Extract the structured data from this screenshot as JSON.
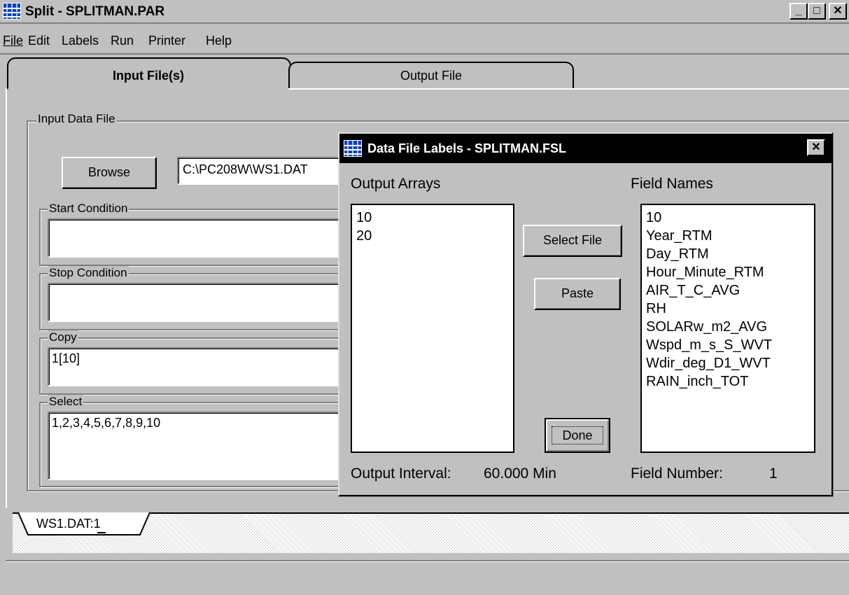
{
  "window": {
    "title": "Split - SPLITMAN.PAR",
    "minimize": "_",
    "maximize": "□",
    "close": "✕"
  },
  "menu": [
    "File",
    "Edit",
    "Labels",
    "Run",
    "Printer",
    "Help"
  ],
  "tabs": {
    "input": "Input File(s)",
    "output": "Output File"
  },
  "input_data_file": {
    "group_label": "Input Data File",
    "browse_label": "Browse",
    "path_value": "C:\\PC208W\\WS1.DAT"
  },
  "start_condition": {
    "label": "Start Condition",
    "value": ""
  },
  "stop_condition": {
    "label": "Stop Condition",
    "value": ""
  },
  "copy": {
    "label": "Copy",
    "value": "1[10]"
  },
  "select": {
    "label": "Select",
    "value": "1,2,3,4,5,6,7,8,9,10"
  },
  "file_tab": "WS1.DAT:1",
  "dialog": {
    "title": "Data File Labels - SPLITMAN.FSL",
    "close": "✕",
    "output_arrays_label": "Output Arrays",
    "output_arrays": [
      "10",
      "20"
    ],
    "field_names_label": "Field Names",
    "field_names": [
      "10",
      "Year_RTM",
      "Day_RTM",
      "Hour_Minute_RTM",
      "AIR_T_C_AVG",
      "RH",
      "SOLARw_m2_AVG",
      "Wspd_m_s_S_WVT",
      "Wdir_deg_D1_WVT",
      "RAIN_inch_TOT"
    ],
    "select_file_label": "Select File",
    "paste_label": "Paste",
    "done_label": "Done",
    "output_interval_label": "Output Interval:",
    "output_interval_value": "60.000 Min",
    "field_number_label": "Field Number:",
    "field_number_value": "1"
  },
  "colors": {
    "face": "#c0c0c0",
    "dialog_title": "#000000",
    "icon_blue": "#1e3ea8"
  }
}
